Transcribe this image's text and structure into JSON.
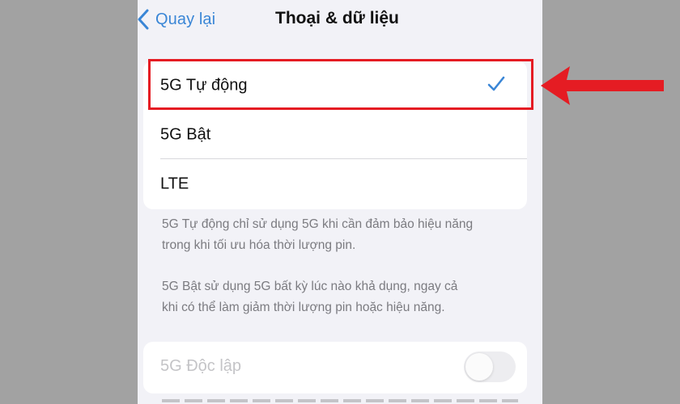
{
  "nav": {
    "back_label": "Quay lại",
    "title": "Thoại & dữ liệu"
  },
  "options": [
    {
      "label": "5G Tự động",
      "selected": true
    },
    {
      "label": "5G Bật",
      "selected": false
    },
    {
      "label": "LTE",
      "selected": false
    }
  ],
  "footnotes": {
    "auto_line1": "5G Tự động chỉ sử dụng 5G khi cần đảm bảo hiệu năng",
    "auto_line2": "trong khi tối ưu hóa thời lượng pin.",
    "on_line1": "5G Bật sử dụng 5G bất kỳ lúc nào khả dụng, ngay cả",
    "on_line2": "khi có thể làm giảm thời lượng pin hoặc hiệu năng."
  },
  "standalone": {
    "label": "5G Độc lập",
    "enabled": false,
    "on": false
  },
  "colors": {
    "accent": "#3a86d6",
    "annotation": "#e51c23",
    "background": "#f2f2f7",
    "outer": "#a2a2a2"
  },
  "icons": {
    "back": "chevron-left-icon",
    "check": "checkmark-icon",
    "annotation": "arrow-left-icon"
  }
}
